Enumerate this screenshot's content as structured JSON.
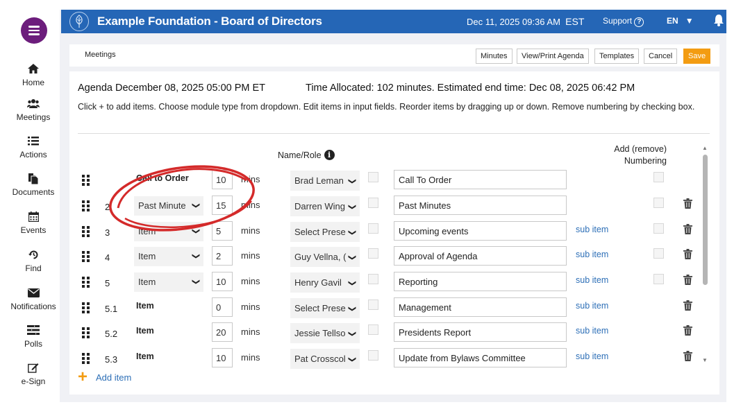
{
  "app": {
    "title": "Example Foundation - Board of Directors",
    "datetime": "Dec 11, 2025 09:36 AM",
    "timezone": "EST",
    "support_label": "Support",
    "language": "EN"
  },
  "sidebar": {
    "items": [
      {
        "label": "Home",
        "icon": "home-icon"
      },
      {
        "label": "Meetings",
        "icon": "users-icon"
      },
      {
        "label": "Actions",
        "icon": "list-icon"
      },
      {
        "label": "Documents",
        "icon": "documents-icon"
      },
      {
        "label": "Events",
        "icon": "calendar-icon"
      },
      {
        "label": "Find",
        "icon": "history-icon"
      },
      {
        "label": "Notifications",
        "icon": "envelope-icon"
      },
      {
        "label": "Polls",
        "icon": "polls-icon"
      },
      {
        "label": "e-Sign",
        "icon": "sign-icon"
      }
    ]
  },
  "toolbar": {
    "breadcrumb": "Meetings",
    "minutes_label": "Minutes",
    "view_print_label": "View/Print Agenda",
    "templates_label": "Templates",
    "cancel_label": "Cancel",
    "save_label": "Save"
  },
  "agenda": {
    "heading": "Agenda December 08, 2025 05:00 PM ET",
    "time_allocated": "Time Allocated: 102 minutes. Estimated end time: Dec 08, 2025 06:42 PM",
    "instructions": "Click + to add items. Choose module type from dropdown. Edit items in input fields. Reorder items by dragging up or down. Remove numbering by checking box.",
    "col_name_role": "Name/Role",
    "col_numbering_line1": "Add (remove)",
    "col_numbering_line2": "Numbering",
    "mins_label": "mins",
    "subitem_label": "sub item",
    "add_item_label": "Add item",
    "rows": [
      {
        "num": "",
        "type": "Call to Order",
        "type_kind": "text",
        "mins": "10",
        "person": "Brad Leman",
        "title": "Call To Order",
        "subitem": false,
        "numbering": true,
        "trash": false
      },
      {
        "num": "2",
        "type": "Past Minute",
        "type_kind": "select",
        "mins": "15",
        "person": "Darren Wing",
        "title": "Past Minutes",
        "subitem": false,
        "numbering": true,
        "trash": true
      },
      {
        "num": "3",
        "type": "Item",
        "type_kind": "select",
        "mins": "5",
        "person": "Select Prese",
        "title": "Upcoming events",
        "subitem": true,
        "numbering": true,
        "trash": true
      },
      {
        "num": "4",
        "type": "Item",
        "type_kind": "select",
        "mins": "2",
        "person": "Guy Vellna, (",
        "title": "Approval of Agenda",
        "subitem": true,
        "numbering": true,
        "trash": true
      },
      {
        "num": "5",
        "type": "Item",
        "type_kind": "select",
        "mins": "10",
        "person": "Henry Gavil",
        "title": "Reporting",
        "subitem": true,
        "numbering": true,
        "trash": true
      },
      {
        "num": "5.1",
        "type": "Item",
        "type_kind": "text",
        "mins": "0",
        "person": "Select Prese",
        "title": "Management",
        "subitem": true,
        "numbering": false,
        "trash": true
      },
      {
        "num": "5.2",
        "type": "Item",
        "type_kind": "text",
        "mins": "20",
        "person": "Jessie Tellso",
        "title": "Presidents Report",
        "subitem": true,
        "numbering": false,
        "trash": true
      },
      {
        "num": "5.3",
        "type": "Item",
        "type_kind": "text",
        "mins": "10",
        "person": "Pat Crosscol",
        "title": "Update from Bylaws Committee",
        "subitem": true,
        "numbering": false,
        "trash": true
      }
    ]
  },
  "colors": {
    "topbar": "#2566b6",
    "brand_purple": "#6c1d7c",
    "save_orange": "#f39c12",
    "link_blue": "#2d6fb7",
    "annotation_red": "#d42a2a"
  }
}
